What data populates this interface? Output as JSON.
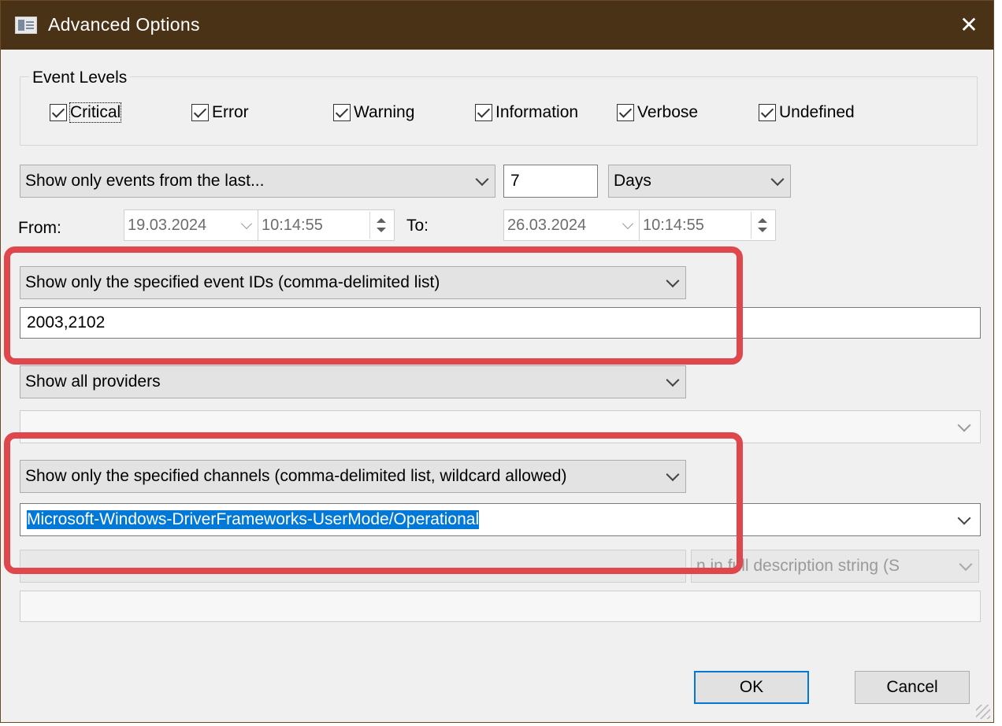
{
  "window": {
    "title": "Advanced Options",
    "close_glyph": "✕"
  },
  "event_levels": {
    "title": "Event Levels",
    "items": [
      {
        "label": "Critical",
        "checked": true
      },
      {
        "label": "Error",
        "checked": true
      },
      {
        "label": "Warning",
        "checked": true
      },
      {
        "label": "Information",
        "checked": true
      },
      {
        "label": "Verbose",
        "checked": true
      },
      {
        "label": "Undefined",
        "checked": true
      }
    ]
  },
  "time_filter": {
    "mode": "Show only events from the last...",
    "amount": "7",
    "unit": "Days",
    "from_label": "From:",
    "from_date": "19.03.2024",
    "from_time": "10:14:55",
    "to_label": "To:",
    "to_date": "26.03.2024",
    "to_time": "10:14:55"
  },
  "event_ids": {
    "mode": "Show only the specified event IDs (comma-delimited list)",
    "value": "2003,2102"
  },
  "providers": {
    "mode": "Show all providers",
    "value": ""
  },
  "channels": {
    "mode": "Show only the specified channels (comma-delimited list, wildcard allowed)",
    "value": "Microsoft-Windows-DriverFrameworks-UserMode/Operational"
  },
  "description": {
    "mode": "",
    "search_scope": "n in full description string (S",
    "value": ""
  },
  "buttons": {
    "ok": "OK",
    "cancel": "Cancel"
  },
  "colors": {
    "titlebar": "#4a3217",
    "highlight": "#e0474c",
    "selection": "#0078d7"
  }
}
